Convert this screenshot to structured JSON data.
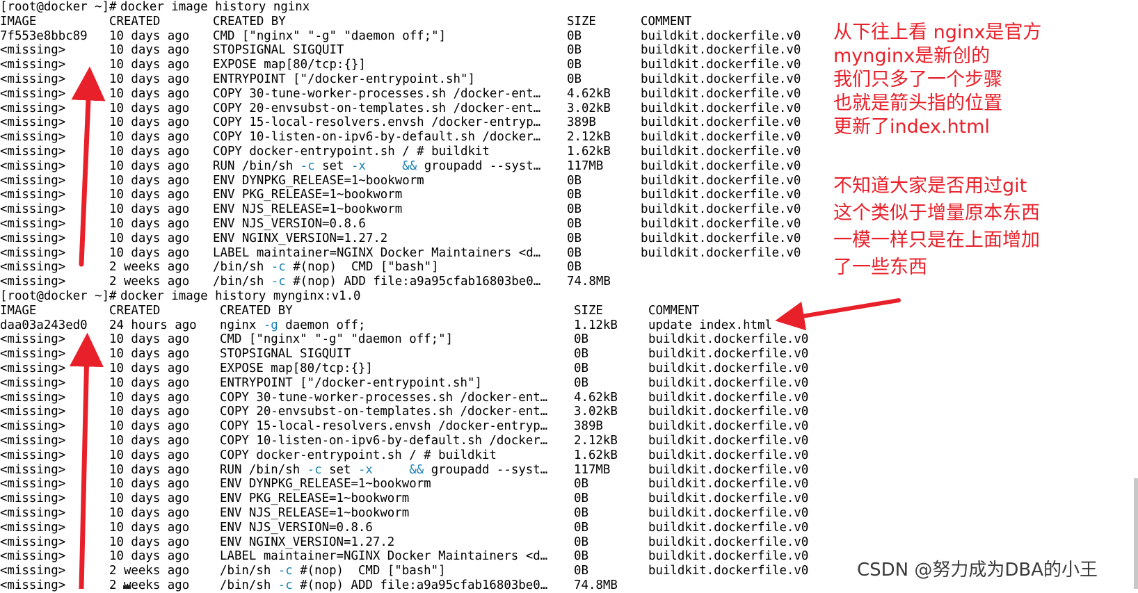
{
  "terminal": {
    "prompt": "[root@docker ~]#",
    "commands": [
      {
        "command": "docker image history nginx",
        "headers": {
          "image": "IMAGE",
          "created": "CREATED",
          "created_by": "CREATED BY",
          "size": "SIZE",
          "comment": "COMMENT"
        },
        "rows": [
          {
            "image": "7f553e8bbc89",
            "created": "10 days ago",
            "created_by": "CMD [\"nginx\" \"-g\" \"daemon off;\"]",
            "size": "0B",
            "comment": "buildkit.dockerfile.v0"
          },
          {
            "image": "<missing>",
            "created": "10 days ago",
            "created_by": "STOPSIGNAL SIGQUIT",
            "size": "0B",
            "comment": "buildkit.dockerfile.v0"
          },
          {
            "image": "<missing>",
            "created": "10 days ago",
            "created_by": "EXPOSE map[80/tcp:{}]",
            "size": "0B",
            "comment": "buildkit.dockerfile.v0"
          },
          {
            "image": "<missing>",
            "created": "10 days ago",
            "created_by": "ENTRYPOINT [\"/docker-entrypoint.sh\"]",
            "size": "0B",
            "comment": "buildkit.dockerfile.v0"
          },
          {
            "image": "<missing>",
            "created": "10 days ago",
            "created_by": "COPY 30-tune-worker-processes.sh /docker-ent…",
            "size": "4.62kB",
            "comment": "buildkit.dockerfile.v0"
          },
          {
            "image": "<missing>",
            "created": "10 days ago",
            "created_by": "COPY 20-envsubst-on-templates.sh /docker-ent…",
            "size": "3.02kB",
            "comment": "buildkit.dockerfile.v0"
          },
          {
            "image": "<missing>",
            "created": "10 days ago",
            "created_by": "COPY 15-local-resolvers.envsh /docker-entryp…",
            "size": "389B",
            "comment": "buildkit.dockerfile.v0"
          },
          {
            "image": "<missing>",
            "created": "10 days ago",
            "created_by": "COPY 10-listen-on-ipv6-by-default.sh /docker…",
            "size": "2.12kB",
            "comment": "buildkit.dockerfile.v0"
          },
          {
            "image": "<missing>",
            "created": "10 days ago",
            "created_by": "COPY docker-entrypoint.sh / # buildkit",
            "size": "1.62kB",
            "comment": "buildkit.dockerfile.v0"
          },
          {
            "image": "<missing>",
            "created": "10 days ago",
            "created_by": "RUN /bin/sh -c set -x     && groupadd --syst…",
            "size": "117MB",
            "comment": "buildkit.dockerfile.v0"
          },
          {
            "image": "<missing>",
            "created": "10 days ago",
            "created_by": "ENV DYNPKG_RELEASE=1~bookworm",
            "size": "0B",
            "comment": "buildkit.dockerfile.v0"
          },
          {
            "image": "<missing>",
            "created": "10 days ago",
            "created_by": "ENV PKG_RELEASE=1~bookworm",
            "size": "0B",
            "comment": "buildkit.dockerfile.v0"
          },
          {
            "image": "<missing>",
            "created": "10 days ago",
            "created_by": "ENV NJS_RELEASE=1~bookworm",
            "size": "0B",
            "comment": "buildkit.dockerfile.v0"
          },
          {
            "image": "<missing>",
            "created": "10 days ago",
            "created_by": "ENV NJS_VERSION=0.8.6",
            "size": "0B",
            "comment": "buildkit.dockerfile.v0"
          },
          {
            "image": "<missing>",
            "created": "10 days ago",
            "created_by": "ENV NGINX_VERSION=1.27.2",
            "size": "0B",
            "comment": "buildkit.dockerfile.v0"
          },
          {
            "image": "<missing>",
            "created": "10 days ago",
            "created_by": "LABEL maintainer=NGINX Docker Maintainers <d…",
            "size": "0B",
            "comment": "buildkit.dockerfile.v0"
          },
          {
            "image": "<missing>",
            "created": "2 weeks ago",
            "created_by": "/bin/sh -c #(nop)  CMD [\"bash\"]",
            "size": "0B",
            "comment": ""
          },
          {
            "image": "<missing>",
            "created": "2 weeks ago",
            "created_by": "/bin/sh -c #(nop) ADD file:a9a95cfab16803be0…",
            "size": "74.8MB",
            "comment": ""
          }
        ]
      },
      {
        "command": "docker image history mynginx:v1.0",
        "headers": {
          "image": "IMAGE",
          "created": "CREATED",
          "created_by": "CREATED BY",
          "size": "SIZE",
          "comment": "COMMENT"
        },
        "rows": [
          {
            "image": "daa03a243ed0",
            "created": "24 hours ago",
            "created_by": "nginx -g daemon off;",
            "size": "1.12kB",
            "comment": "update index.html"
          },
          {
            "image": "<missing>",
            "created": "10 days ago",
            "created_by": "CMD [\"nginx\" \"-g\" \"daemon off;\"]",
            "size": "0B",
            "comment": "buildkit.dockerfile.v0"
          },
          {
            "image": "<missing>",
            "created": "10 days ago",
            "created_by": "STOPSIGNAL SIGQUIT",
            "size": "0B",
            "comment": "buildkit.dockerfile.v0"
          },
          {
            "image": "<missing>",
            "created": "10 days ago",
            "created_by": "EXPOSE map[80/tcp:{}]",
            "size": "0B",
            "comment": "buildkit.dockerfile.v0"
          },
          {
            "image": "<missing>",
            "created": "10 days ago",
            "created_by": "ENTRYPOINT [\"/docker-entrypoint.sh\"]",
            "size": "0B",
            "comment": "buildkit.dockerfile.v0"
          },
          {
            "image": "<missing>",
            "created": "10 days ago",
            "created_by": "COPY 30-tune-worker-processes.sh /docker-ent…",
            "size": "4.62kB",
            "comment": "buildkit.dockerfile.v0"
          },
          {
            "image": "<missing>",
            "created": "10 days ago",
            "created_by": "COPY 20-envsubst-on-templates.sh /docker-ent…",
            "size": "3.02kB",
            "comment": "buildkit.dockerfile.v0"
          },
          {
            "image": "<missing>",
            "created": "10 days ago",
            "created_by": "COPY 15-local-resolvers.envsh /docker-entryp…",
            "size": "389B",
            "comment": "buildkit.dockerfile.v0"
          },
          {
            "image": "<missing>",
            "created": "10 days ago",
            "created_by": "COPY 10-listen-on-ipv6-by-default.sh /docker…",
            "size": "2.12kB",
            "comment": "buildkit.dockerfile.v0"
          },
          {
            "image": "<missing>",
            "created": "10 days ago",
            "created_by": "COPY docker-entrypoint.sh / # buildkit",
            "size": "1.62kB",
            "comment": "buildkit.dockerfile.v0"
          },
          {
            "image": "<missing>",
            "created": "10 days ago",
            "created_by": "RUN /bin/sh -c set -x     && groupadd --syst…",
            "size": "117MB",
            "comment": "buildkit.dockerfile.v0"
          },
          {
            "image": "<missing>",
            "created": "10 days ago",
            "created_by": "ENV DYNPKG_RELEASE=1~bookworm",
            "size": "0B",
            "comment": "buildkit.dockerfile.v0"
          },
          {
            "image": "<missing>",
            "created": "10 days ago",
            "created_by": "ENV PKG_RELEASE=1~bookworm",
            "size": "0B",
            "comment": "buildkit.dockerfile.v0"
          },
          {
            "image": "<missing>",
            "created": "10 days ago",
            "created_by": "ENV NJS_RELEASE=1~bookworm",
            "size": "0B",
            "comment": "buildkit.dockerfile.v0"
          },
          {
            "image": "<missing>",
            "created": "10 days ago",
            "created_by": "ENV NJS_VERSION=0.8.6",
            "size": "0B",
            "comment": "buildkit.dockerfile.v0"
          },
          {
            "image": "<missing>",
            "created": "10 days ago",
            "created_by": "ENV NGINX_VERSION=1.27.2",
            "size": "0B",
            "comment": "buildkit.dockerfile.v0"
          },
          {
            "image": "<missing>",
            "created": "10 days ago",
            "created_by": "LABEL maintainer=NGINX Docker Maintainers <d…",
            "size": "0B",
            "comment": "buildkit.dockerfile.v0"
          },
          {
            "image": "<missing>",
            "created": "2 weeks ago",
            "created_by": "/bin/sh -c #(nop)  CMD [\"bash\"]",
            "size": "0B",
            "comment": "buildkit.dockerfile.v0"
          },
          {
            "image": "<missing>",
            "created": "2 weeks ago",
            "created_by": "/bin/sh -c #(nop) ADD file:a9a95cfab16803be0…",
            "size": "74.8MB",
            "comment": ""
          }
        ]
      }
    ]
  },
  "annotations": {
    "note_1_lines": [
      "从下往上看 nginx是官方",
      "mynginx是新创的",
      "我们只多了一个步骤",
      "也就是箭头指的位置",
      "更新了index.html"
    ],
    "note_2_lines": [
      "不知道大家是否用过git",
      "这个类似于增量原本东西",
      "一模一样只是在上面增加",
      "了一些东西"
    ],
    "arrow_color": "#e8202a"
  },
  "watermark": "CSDN @努力成为DBA的小王",
  "colors": {
    "background": "#ffffff",
    "text": "#000000",
    "option_highlight": "#1a7fb4",
    "annotation": "#e8202a"
  }
}
